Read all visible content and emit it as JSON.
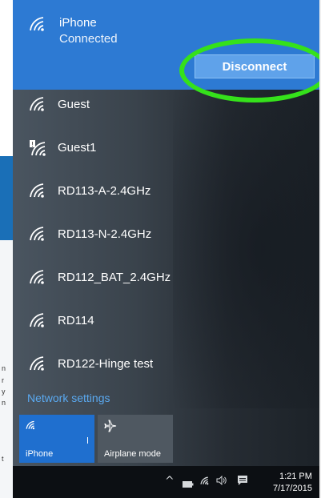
{
  "connected_network": {
    "name": "iPhone",
    "status": "Connected",
    "disconnect_label": "Disconnect"
  },
  "networks": [
    {
      "name": "Guest",
      "icon": "wifi-icon"
    },
    {
      "name": "Guest1",
      "icon": "wifi-unsecured-icon"
    },
    {
      "name": "RD113-A-2.4GHz",
      "icon": "wifi-icon"
    },
    {
      "name": "RD113-N-2.4GHz",
      "icon": "wifi-icon"
    },
    {
      "name": "RD112_BAT_2.4GHz",
      "icon": "wifi-icon"
    },
    {
      "name": "RD114",
      "icon": "wifi-icon"
    },
    {
      "name": "RD122-Hinge test",
      "icon": "wifi-icon"
    }
  ],
  "network_settings_label": "Network settings",
  "quick_actions": {
    "wifi_label": "iPhone",
    "airplane_label": "Airplane mode"
  },
  "taskbar": {
    "time": "1:21 PM",
    "date": "7/17/2015",
    "icons": [
      "chevron-up-icon",
      "battery-icon",
      "wifi-icon",
      "speaker-icon",
      "action-center-icon"
    ]
  },
  "colors": {
    "selected_bg": "#2d7ad3",
    "accent_link": "#5aa9f0",
    "highlight_ring": "#35e11b",
    "wifi_tile": "#1f6fcf"
  }
}
